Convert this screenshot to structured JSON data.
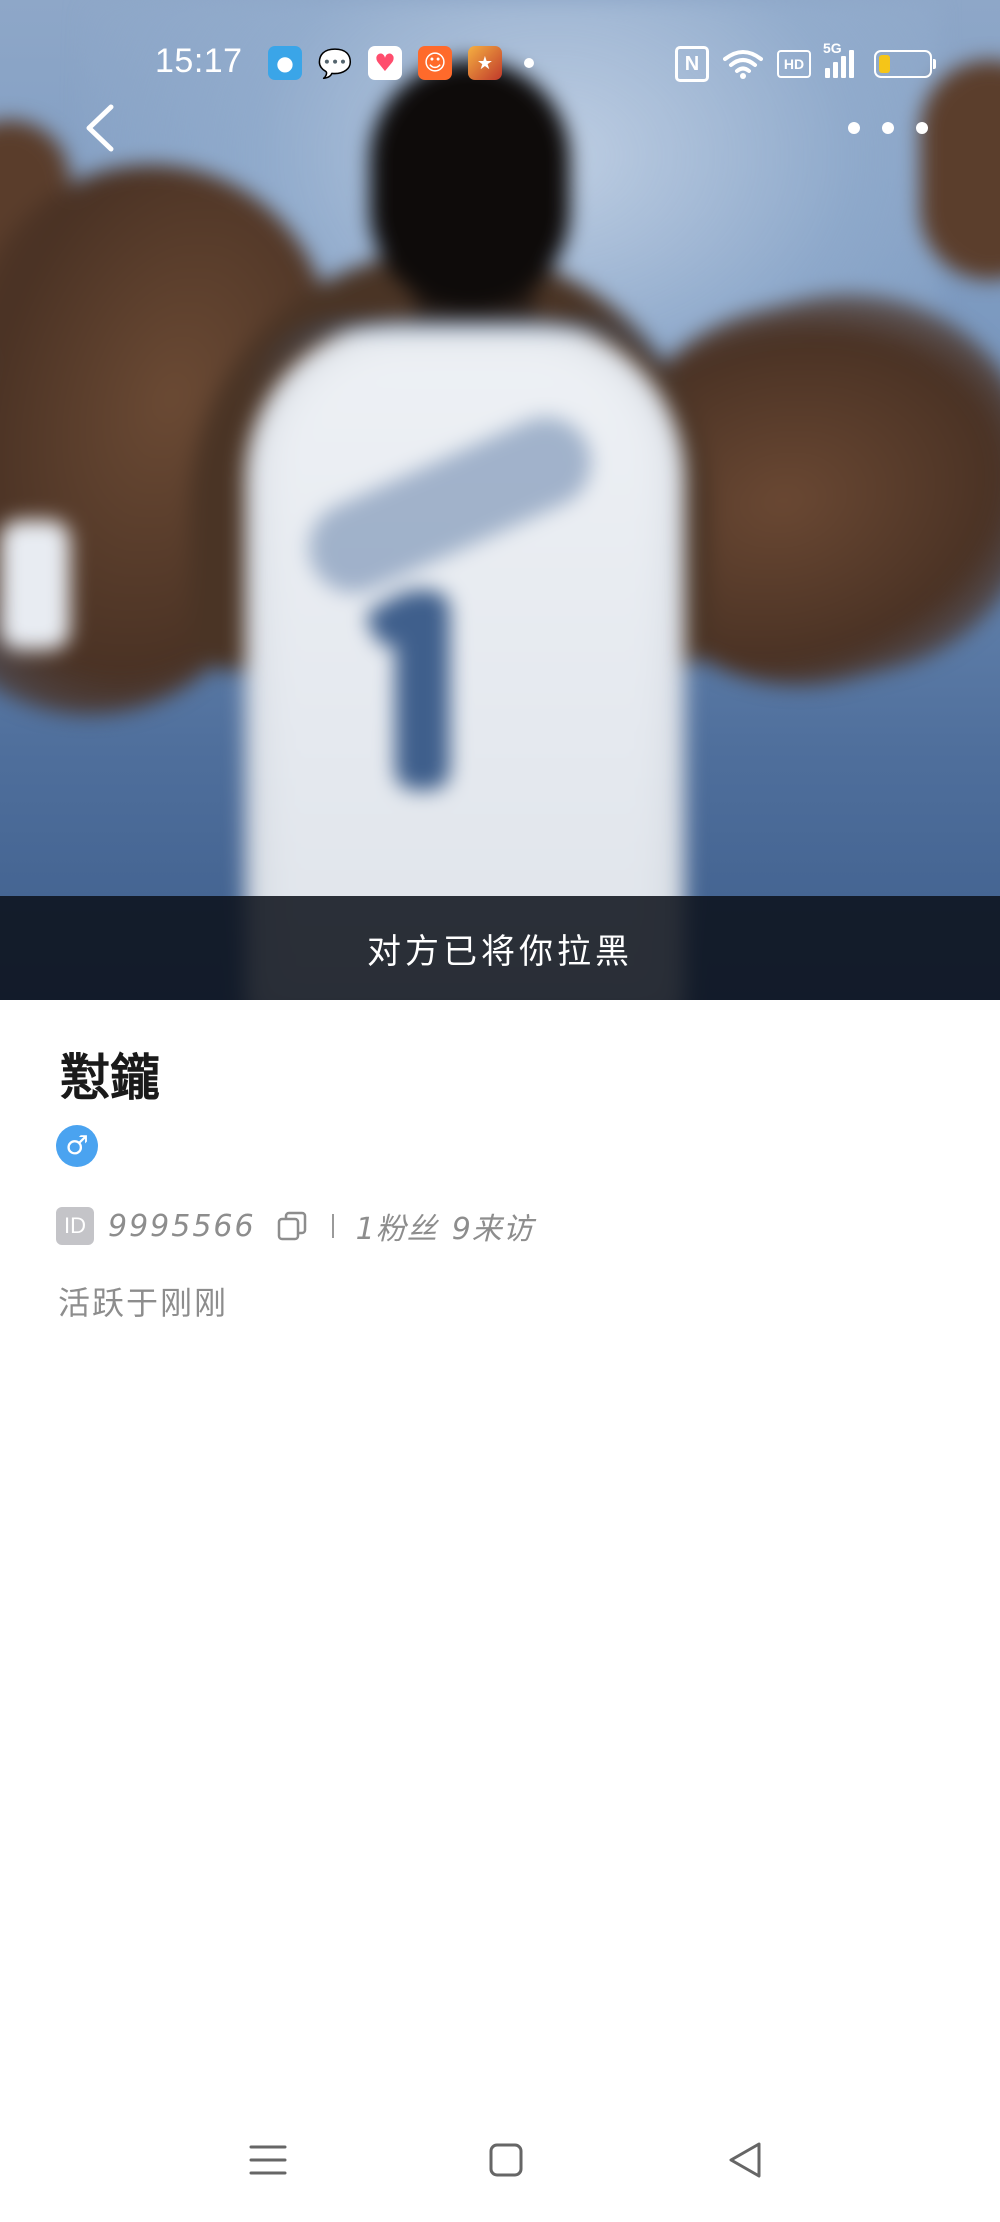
{
  "status_bar": {
    "time": "15:17",
    "battery_level": 0.25,
    "network_label": "5G",
    "hd_label": "HD",
    "nfc_label": "N",
    "notification_icons": [
      "app-blue-icon",
      "wechat-icon",
      "heart-app-icon",
      "orange-app-icon",
      "game-app-icon",
      "notification-dot"
    ]
  },
  "header": {
    "back_icon": "back-arrow-icon",
    "more_icon": "more-icon"
  },
  "hero": {
    "banner_text": "对方已将你拉黑"
  },
  "profile": {
    "name": "懟鑨",
    "gender_symbol": "♂",
    "gender": "male",
    "id_badge": "ID",
    "id_value": "9995566",
    "divider": "|",
    "fans": "1粉丝",
    "visitors": "9来访",
    "active_status": "活跃于刚刚"
  },
  "colors": {
    "gender_badge": "#4aa3f0",
    "banner_bg": "#0c101a",
    "secondary_text": "#8d8d8d",
    "battery_fill": "#f5c518"
  },
  "nav_bar": {
    "menu_icon": "menu-icon",
    "home_icon": "home-icon",
    "back_icon": "triangle-back-icon"
  }
}
